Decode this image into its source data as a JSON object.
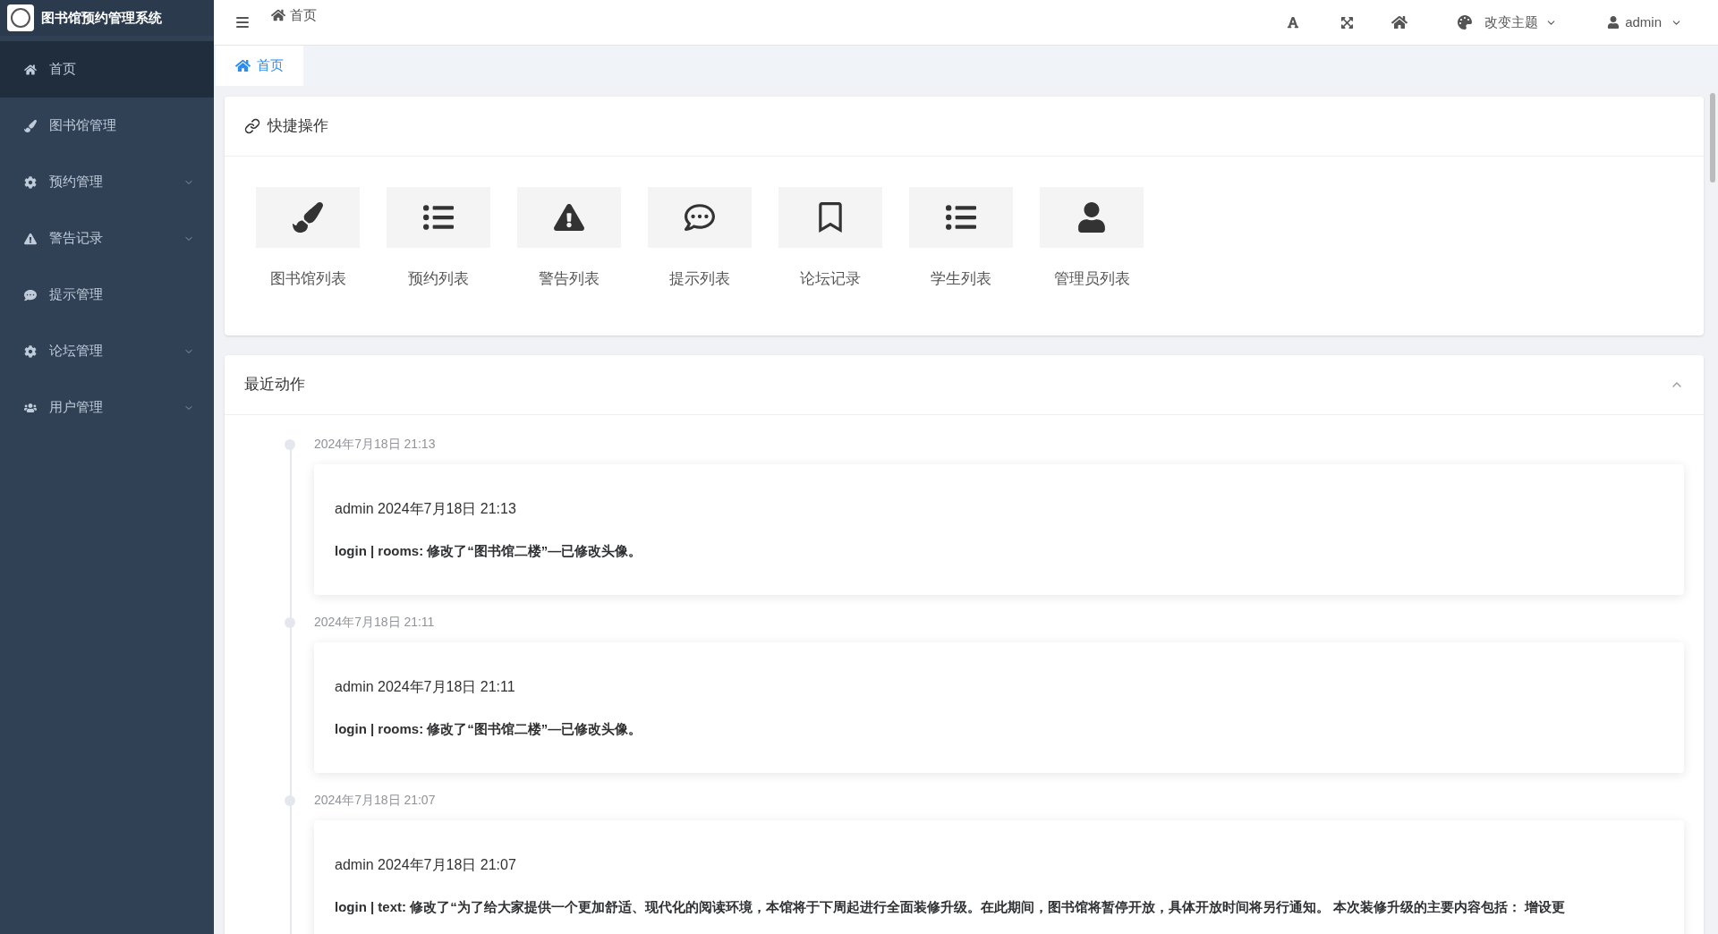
{
  "app": {
    "title": "图书馆预约管理系统"
  },
  "sidebar": {
    "items": [
      {
        "label": "首页",
        "selected": true,
        "kind": "link"
      },
      {
        "label": "图书馆管理",
        "selected": false,
        "kind": "link"
      },
      {
        "label": "预约管理",
        "selected": false,
        "kind": "group"
      },
      {
        "label": "警告记录",
        "selected": false,
        "kind": "group"
      },
      {
        "label": "提示管理",
        "selected": false,
        "kind": "link"
      },
      {
        "label": "论坛管理",
        "selected": false,
        "kind": "group"
      },
      {
        "label": "用户管理",
        "selected": false,
        "kind": "group"
      }
    ]
  },
  "header": {
    "breadcrumb": "首页",
    "theme_label": "改变主题",
    "user": "admin"
  },
  "tabs": [
    {
      "label": "首页",
      "selected": true
    }
  ],
  "quick_actions": {
    "title": "快捷操作",
    "items": [
      {
        "label": "图书馆列表"
      },
      {
        "label": "预约列表"
      },
      {
        "label": "警告列表"
      },
      {
        "label": "提示列表"
      },
      {
        "label": "论坛记录"
      },
      {
        "label": "学生列表"
      },
      {
        "label": "管理员列表"
      }
    ]
  },
  "recent": {
    "title": "最近动作",
    "expanded": true,
    "entries": [
      {
        "time": "2024年7月18日 21:13",
        "header": "admin 2024年7月18日 21:13",
        "text": "login | rooms: 修改了“图书馆二楼”—已修改头像。"
      },
      {
        "time": "2024年7月18日 21:11",
        "header": "admin 2024年7月18日 21:11",
        "text": "login | rooms: 修改了“图书馆二楼”—已修改头像。"
      },
      {
        "time": "2024年7月18日 21:07",
        "header": "admin 2024年7月18日 21:07",
        "text": "login | text: 修改了“为了给大家提供一个更加舒适、现代化的阅读环境，本馆将于下周起进行全面装修升级。在此期间，图书馆将暂停开放，具体开放时间将另行通知。 本次装修升级的主要内容包括： 增设更"
      }
    ]
  }
}
